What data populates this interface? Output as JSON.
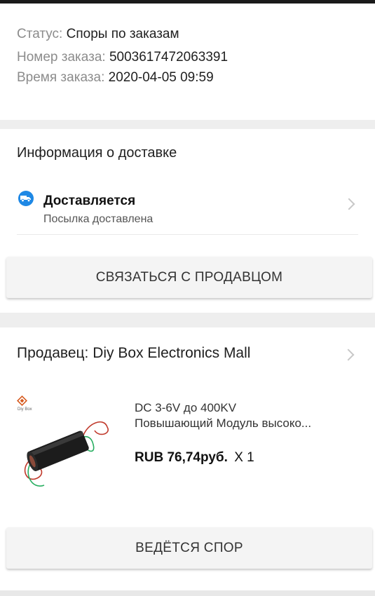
{
  "order": {
    "status_label": "Статус:",
    "status_value": "Споры по заказам",
    "number_label": "Номер заказа:",
    "number_value": "5003617472063391",
    "time_label": "Время заказа:",
    "time_value": "2020-04-05 09:59"
  },
  "delivery": {
    "title": "Информация о доставке",
    "status_title": "Доставляется",
    "status_sub": "Посылка доставлена",
    "icon": "truck-icon",
    "contact_button": "СВЯЗАТЬСЯ С ПРОДАВЦОМ"
  },
  "seller": {
    "title": "Продавец: Diy Box Electronics Mall",
    "product": {
      "name_line1": "DC 3-6V до 400KV",
      "name_line2": "Повышающий Модуль высоко...",
      "price": "RUB 76,74руб.",
      "quantity": "X 1",
      "brand_mark": "Diy Box"
    },
    "dispute_button": "ВЕДЁТСЯ СПОР"
  },
  "colors": {
    "accent": "#1e88e5",
    "background": "#eeeeee",
    "card": "#ffffff"
  }
}
